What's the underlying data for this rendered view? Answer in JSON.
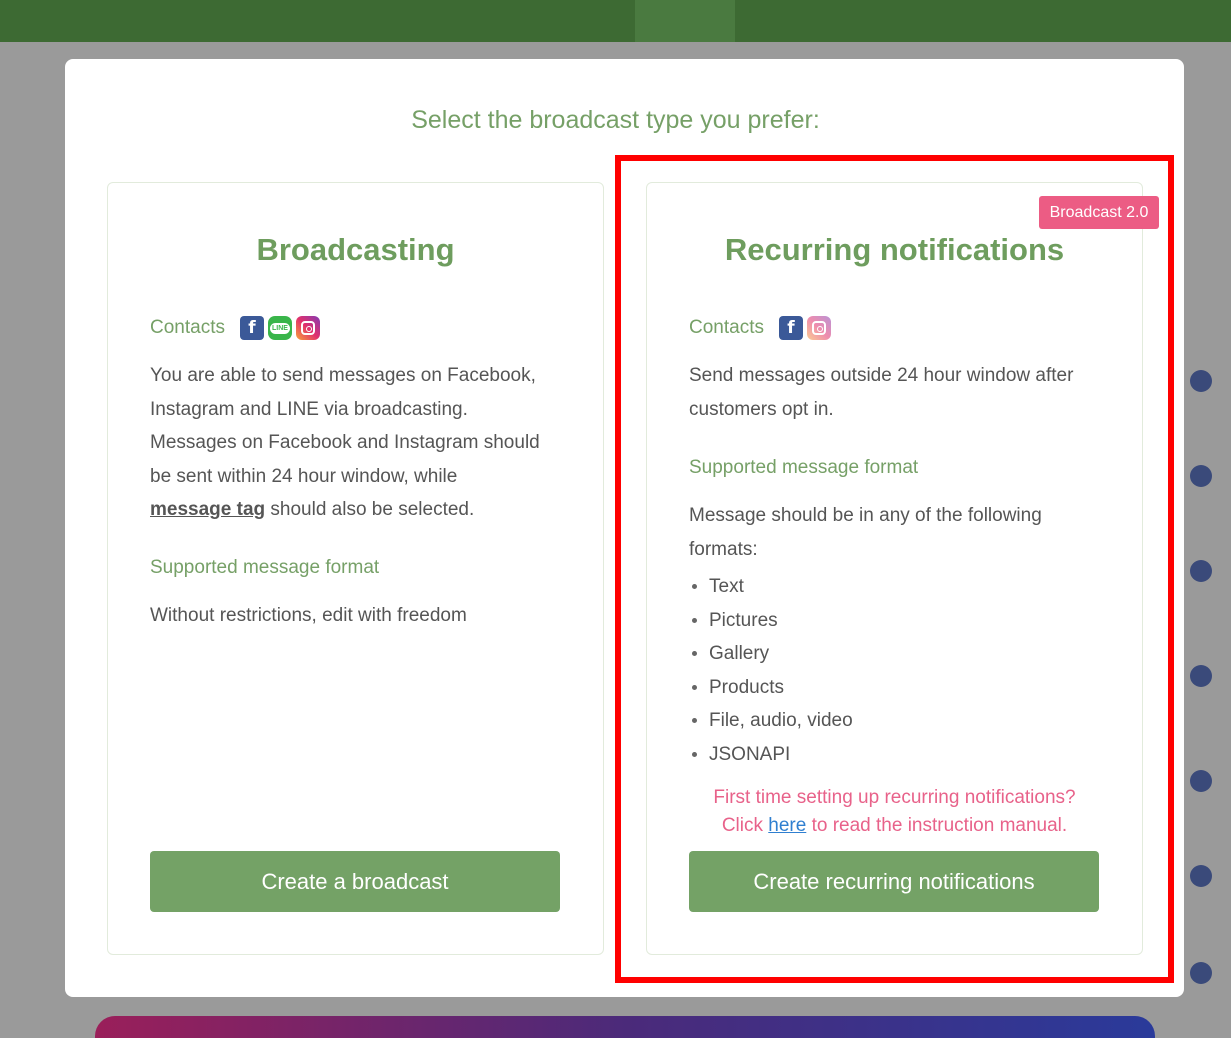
{
  "modal": {
    "title": "Select the broadcast type you prefer:"
  },
  "cards": {
    "broadcasting": {
      "title": "Broadcasting",
      "contacts_label": "Contacts",
      "channel_icons": [
        "facebook-icon",
        "line-icon",
        "instagram-icon"
      ],
      "description_1": "You are able to send messages on Facebook,",
      "description_2": "Instagram and LINE via broadcasting.",
      "description_3": "Messages on Facebook and Instagram should",
      "description_4": "be sent within 24 hour window, while",
      "description_tag": "message tag",
      "description_5": " should also be selected.",
      "format_label": "Supported message format",
      "format_text": "Without restrictions, edit with freedom",
      "button_label": "Create a broadcast"
    },
    "recurring": {
      "title": "Recurring notifications",
      "badge": "Broadcast 2.0",
      "contacts_label": "Contacts",
      "channel_icons": [
        "facebook-icon",
        "instagram-icon"
      ],
      "description_1": "Send messages outside 24 hour window after",
      "description_2": "customers opt in.",
      "format_label": "Supported message format",
      "format_text_1": "Message should be in any of the following",
      "format_text_2": "formats:",
      "formats": [
        "Text",
        "Pictures",
        "Gallery",
        "Products",
        "File, audio, video",
        "JSONAPI"
      ],
      "hint_line_1": "First time setting up recurring notifications?",
      "hint_prefix": "Click ",
      "hint_link": "here",
      "hint_suffix": " to read the instruction manual.",
      "button_label": "Create recurring notifications"
    }
  },
  "colors": {
    "accent_green": "#74a266",
    "badge_pink": "#ec5c84",
    "hint_pink": "#e8628a",
    "link_blue": "#2f7fd0",
    "highlight_red": "#ff0000"
  }
}
